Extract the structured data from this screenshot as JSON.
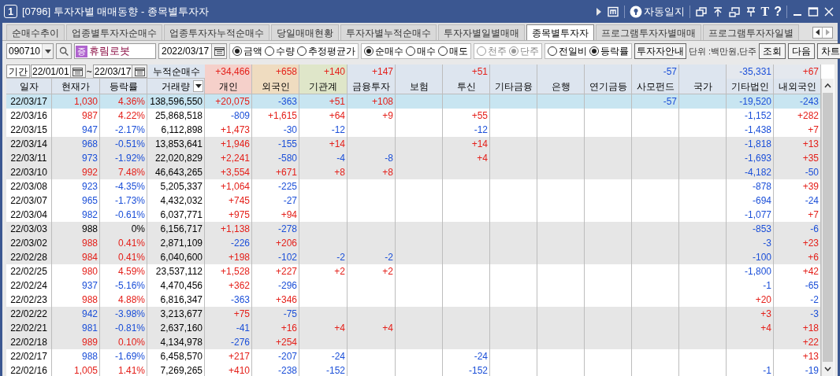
{
  "window": {
    "badge": "1",
    "title": "[0796] 투자자별 매매동향 - 종목별투자자",
    "journal_label": "자동일지",
    "text_tool": "T",
    "help": "?"
  },
  "tabs": [
    {
      "label": "순매수추이",
      "selected": false
    },
    {
      "label": "업종별투자자순매수",
      "selected": false
    },
    {
      "label": "업종투자자누적순매수",
      "selected": false
    },
    {
      "label": "당일매매현황",
      "selected": false
    },
    {
      "label": "투자자별누적순매수",
      "selected": false
    },
    {
      "label": "투자자별일별매매",
      "selected": false
    },
    {
      "label": "종목별투자자",
      "selected": true
    },
    {
      "label": "프로그램투자자별매매",
      "selected": false
    },
    {
      "label": "프로그램투자자일별",
      "selected": false
    }
  ],
  "filters": {
    "code": "090710",
    "market_badge": "증",
    "stock_name": "휴림로봇",
    "date": "2022/03/17",
    "radio_groups": [
      {
        "disabled": false,
        "options": [
          {
            "label": "금액",
            "selected": true
          },
          {
            "label": "수량",
            "selected": false
          },
          {
            "label": "추정평균가",
            "selected": false
          }
        ]
      },
      {
        "disabled": false,
        "options": [
          {
            "label": "순매수",
            "selected": true
          },
          {
            "label": "매수",
            "selected": false
          },
          {
            "label": "매도",
            "selected": false
          }
        ]
      },
      {
        "disabled": true,
        "options": [
          {
            "label": "천주",
            "selected": false
          },
          {
            "label": "단주",
            "selected": true
          }
        ]
      },
      {
        "disabled": false,
        "options": [
          {
            "label": "전일비",
            "selected": false
          },
          {
            "label": "등락률",
            "selected": true
          }
        ]
      }
    ],
    "guide_button": "투자자안내",
    "unit": "단위 :백만원,단주",
    "buttons": [
      "조회",
      "다음",
      "차트"
    ]
  },
  "period": {
    "label": "기간",
    "from": "22/01/01",
    "separator": "~",
    "to": "22/03/17"
  },
  "summary": {
    "label": "누적순매수",
    "flows": {
      "individual": {
        "t": "+34,466",
        "color": "#e4201a"
      },
      "foreign": {
        "t": "+658",
        "color": "#e4201a"
      },
      "institution": {
        "t": "+140",
        "color": "#e4201a"
      },
      "financial_investment": {
        "t": "+147",
        "color": "#e4201a"
      },
      "trust": {
        "t": "+51",
        "color": "#e4201a"
      },
      "private_fund": {
        "t": "-57",
        "color": "#1b4fd8"
      },
      "other_corp": {
        "t": "-35,331",
        "color": "#1b4fd8"
      },
      "domestic_foreign": {
        "t": "+67",
        "color": "#e4201a"
      }
    }
  },
  "table": {
    "columns": [
      "일자",
      "현재가",
      "등락률",
      "거래량",
      "개인",
      "외국인",
      "기관계",
      "금융투자",
      "보험",
      "투신",
      "기타금융",
      "은행",
      "연기금등",
      "사모펀드",
      "국가",
      "기타법인",
      "내외국인"
    ],
    "rows": [
      {
        "selected": true,
        "date": "22/03/17",
        "price": "1,030",
        "rate": "4.36%",
        "color": "#e4201a",
        "volume": "138,596,550",
        "flows": {
          "individual": {
            "t": "+20,075",
            "color": "#e4201a"
          },
          "foreign": {
            "t": "-363",
            "color": "#1b4fd8"
          },
          "institution": {
            "t": "+51",
            "color": "#e4201a"
          },
          "financial_investment": {
            "t": "+108",
            "color": "#e4201a"
          },
          "private_fund": {
            "t": "-57",
            "color": "#1b4fd8"
          },
          "other_corp": {
            "t": "-19,520",
            "color": "#1b4fd8"
          },
          "domestic_foreign": {
            "t": "-243",
            "color": "#1b4fd8"
          }
        }
      },
      {
        "selected": false,
        "date": "22/03/16",
        "price": "987",
        "rate": "4.22%",
        "color": "#e4201a",
        "volume": "25,868,518",
        "flows": {
          "individual": {
            "t": "-809",
            "color": "#1b4fd8"
          },
          "foreign": {
            "t": "+1,615",
            "color": "#e4201a"
          },
          "institution": {
            "t": "+64",
            "color": "#e4201a"
          },
          "financial_investment": {
            "t": "+9",
            "color": "#e4201a"
          },
          "trust": {
            "t": "+55",
            "color": "#e4201a"
          },
          "other_corp": {
            "t": "-1,152",
            "color": "#1b4fd8"
          },
          "domestic_foreign": {
            "t": "+282",
            "color": "#e4201a"
          }
        }
      },
      {
        "selected": false,
        "date": "22/03/15",
        "price": "947",
        "rate": "-2.17%",
        "color": "#1b4fd8",
        "volume": "6,112,898",
        "flows": {
          "individual": {
            "t": "+1,473",
            "color": "#e4201a"
          },
          "foreign": {
            "t": "-30",
            "color": "#1b4fd8"
          },
          "institution": {
            "t": "-12",
            "color": "#1b4fd8"
          },
          "trust": {
            "t": "-12",
            "color": "#1b4fd8"
          },
          "other_corp": {
            "t": "-1,438",
            "color": "#1b4fd8"
          },
          "domestic_foreign": {
            "t": "+7",
            "color": "#e4201a"
          }
        }
      },
      {
        "selected": false,
        "date": "22/03/14",
        "price": "968",
        "rate": "-0.51%",
        "color": "#1b4fd8",
        "volume": "13,853,641",
        "flows": {
          "individual": {
            "t": "+1,946",
            "color": "#e4201a"
          },
          "foreign": {
            "t": "-155",
            "color": "#1b4fd8"
          },
          "institution": {
            "t": "+14",
            "color": "#e4201a"
          },
          "trust": {
            "t": "+14",
            "color": "#e4201a"
          },
          "other_corp": {
            "t": "-1,818",
            "color": "#1b4fd8"
          },
          "domestic_foreign": {
            "t": "+13",
            "color": "#e4201a"
          }
        }
      },
      {
        "selected": false,
        "date": "22/03/11",
        "price": "973",
        "rate": "-1.92%",
        "color": "#1b4fd8",
        "volume": "22,020,829",
        "flows": {
          "individual": {
            "t": "+2,241",
            "color": "#e4201a"
          },
          "foreign": {
            "t": "-580",
            "color": "#1b4fd8"
          },
          "institution": {
            "t": "-4",
            "color": "#1b4fd8"
          },
          "financial_investment": {
            "t": "-8",
            "color": "#1b4fd8"
          },
          "trust": {
            "t": "+4",
            "color": "#e4201a"
          },
          "other_corp": {
            "t": "-1,693",
            "color": "#1b4fd8"
          },
          "domestic_foreign": {
            "t": "+35",
            "color": "#e4201a"
          }
        }
      },
      {
        "selected": false,
        "date": "22/03/10",
        "price": "992",
        "rate": "7.48%",
        "color": "#e4201a",
        "volume": "46,643,265",
        "flows": {
          "individual": {
            "t": "+3,554",
            "color": "#e4201a"
          },
          "foreign": {
            "t": "+671",
            "color": "#e4201a"
          },
          "institution": {
            "t": "+8",
            "color": "#e4201a"
          },
          "financial_investment": {
            "t": "+8",
            "color": "#e4201a"
          },
          "other_corp": {
            "t": "-4,182",
            "color": "#1b4fd8"
          },
          "domestic_foreign": {
            "t": "-50",
            "color": "#1b4fd8"
          }
        }
      },
      {
        "selected": false,
        "date": "22/03/08",
        "price": "923",
        "rate": "-4.35%",
        "color": "#1b4fd8",
        "volume": "5,205,337",
        "flows": {
          "individual": {
            "t": "+1,064",
            "color": "#e4201a"
          },
          "foreign": {
            "t": "-225",
            "color": "#1b4fd8"
          },
          "other_corp": {
            "t": "-878",
            "color": "#1b4fd8"
          },
          "domestic_foreign": {
            "t": "+39",
            "color": "#e4201a"
          }
        }
      },
      {
        "selected": false,
        "date": "22/03/07",
        "price": "965",
        "rate": "-1.73%",
        "color": "#1b4fd8",
        "volume": "4,432,032",
        "flows": {
          "individual": {
            "t": "+745",
            "color": "#e4201a"
          },
          "foreign": {
            "t": "-27",
            "color": "#1b4fd8"
          },
          "other_corp": {
            "t": "-694",
            "color": "#1b4fd8"
          },
          "domestic_foreign": {
            "t": "-24",
            "color": "#1b4fd8"
          }
        }
      },
      {
        "selected": false,
        "date": "22/03/04",
        "price": "982",
        "rate": "-0.61%",
        "color": "#1b4fd8",
        "volume": "6,037,771",
        "flows": {
          "individual": {
            "t": "+975",
            "color": "#e4201a"
          },
          "foreign": {
            "t": "+94",
            "color": "#e4201a"
          },
          "other_corp": {
            "t": "-1,077",
            "color": "#1b4fd8"
          },
          "domestic_foreign": {
            "t": "+7",
            "color": "#e4201a"
          }
        }
      },
      {
        "selected": false,
        "date": "22/03/03",
        "price": "988",
        "rate": "0%",
        "color": "#000000",
        "volume": "6,156,717",
        "flows": {
          "individual": {
            "t": "+1,138",
            "color": "#e4201a"
          },
          "foreign": {
            "t": "-278",
            "color": "#1b4fd8"
          },
          "other_corp": {
            "t": "-853",
            "color": "#1b4fd8"
          },
          "domestic_foreign": {
            "t": "-6",
            "color": "#1b4fd8"
          }
        }
      },
      {
        "selected": false,
        "date": "22/03/02",
        "price": "988",
        "rate": "0.41%",
        "color": "#e4201a",
        "volume": "2,871,109",
        "flows": {
          "individual": {
            "t": "-226",
            "color": "#1b4fd8"
          },
          "foreign": {
            "t": "+206",
            "color": "#e4201a"
          },
          "other_corp": {
            "t": "-3",
            "color": "#1b4fd8"
          },
          "domestic_foreign": {
            "t": "+23",
            "color": "#e4201a"
          }
        }
      },
      {
        "selected": false,
        "date": "22/02/28",
        "price": "984",
        "rate": "0.41%",
        "color": "#e4201a",
        "volume": "6,040,600",
        "flows": {
          "individual": {
            "t": "+198",
            "color": "#e4201a"
          },
          "foreign": {
            "t": "-102",
            "color": "#1b4fd8"
          },
          "institution": {
            "t": "-2",
            "color": "#1b4fd8"
          },
          "financial_investment": {
            "t": "-2",
            "color": "#1b4fd8"
          },
          "other_corp": {
            "t": "-100",
            "color": "#1b4fd8"
          },
          "domestic_foreign": {
            "t": "+6",
            "color": "#e4201a"
          }
        }
      },
      {
        "selected": false,
        "date": "22/02/25",
        "price": "980",
        "rate": "4.59%",
        "color": "#e4201a",
        "volume": "23,537,112",
        "flows": {
          "individual": {
            "t": "+1,528",
            "color": "#e4201a"
          },
          "foreign": {
            "t": "+227",
            "color": "#e4201a"
          },
          "institution": {
            "t": "+2",
            "color": "#e4201a"
          },
          "financial_investment": {
            "t": "+2",
            "color": "#e4201a"
          },
          "other_corp": {
            "t": "-1,800",
            "color": "#1b4fd8"
          },
          "domestic_foreign": {
            "t": "+42",
            "color": "#e4201a"
          }
        }
      },
      {
        "selected": false,
        "date": "22/02/24",
        "price": "937",
        "rate": "-5.16%",
        "color": "#1b4fd8",
        "volume": "4,470,456",
        "flows": {
          "individual": {
            "t": "+362",
            "color": "#e4201a"
          },
          "foreign": {
            "t": "-296",
            "color": "#1b4fd8"
          },
          "other_corp": {
            "t": "-1",
            "color": "#1b4fd8"
          },
          "domestic_foreign": {
            "t": "-65",
            "color": "#1b4fd8"
          }
        }
      },
      {
        "selected": false,
        "date": "22/02/23",
        "price": "988",
        "rate": "4.88%",
        "color": "#e4201a",
        "volume": "6,816,347",
        "flows": {
          "individual": {
            "t": "-363",
            "color": "#1b4fd8"
          },
          "foreign": {
            "t": "+346",
            "color": "#e4201a"
          },
          "other_corp": {
            "t": "+20",
            "color": "#e4201a"
          },
          "domestic_foreign": {
            "t": "-2",
            "color": "#1b4fd8"
          }
        }
      },
      {
        "selected": false,
        "date": "22/02/22",
        "price": "942",
        "rate": "-3.98%",
        "color": "#1b4fd8",
        "volume": "3,213,677",
        "flows": {
          "individual": {
            "t": "+75",
            "color": "#e4201a"
          },
          "foreign": {
            "t": "-75",
            "color": "#1b4fd8"
          },
          "other_corp": {
            "t": "+3",
            "color": "#e4201a"
          },
          "domestic_foreign": {
            "t": "-3",
            "color": "#1b4fd8"
          }
        }
      },
      {
        "selected": false,
        "date": "22/02/21",
        "price": "981",
        "rate": "-0.81%",
        "color": "#1b4fd8",
        "volume": "2,637,160",
        "flows": {
          "individual": {
            "t": "-41",
            "color": "#1b4fd8"
          },
          "foreign": {
            "t": "+16",
            "color": "#e4201a"
          },
          "institution": {
            "t": "+4",
            "color": "#e4201a"
          },
          "financial_investment": {
            "t": "+4",
            "color": "#e4201a"
          },
          "other_corp": {
            "t": "+4",
            "color": "#e4201a"
          },
          "domestic_foreign": {
            "t": "+18",
            "color": "#e4201a"
          }
        }
      },
      {
        "selected": false,
        "date": "22/02/18",
        "price": "989",
        "rate": "0.10%",
        "color": "#e4201a",
        "volume": "4,134,978",
        "flows": {
          "individual": {
            "t": "-276",
            "color": "#1b4fd8"
          },
          "foreign": {
            "t": "+254",
            "color": "#e4201a"
          },
          "domestic_foreign": {
            "t": "+22",
            "color": "#e4201a"
          }
        }
      },
      {
        "selected": false,
        "date": "22/02/17",
        "price": "988",
        "rate": "-1.69%",
        "color": "#1b4fd8",
        "volume": "6,458,570",
        "flows": {
          "individual": {
            "t": "+217",
            "color": "#e4201a"
          },
          "foreign": {
            "t": "-207",
            "color": "#1b4fd8"
          },
          "institution": {
            "t": "-24",
            "color": "#1b4fd8"
          },
          "trust": {
            "t": "-24",
            "color": "#1b4fd8"
          },
          "domestic_foreign": {
            "t": "+13",
            "color": "#e4201a"
          }
        }
      },
      {
        "selected": false,
        "date": "22/02/16",
        "price": "1,005",
        "rate": "1.41%",
        "color": "#e4201a",
        "volume": "7,269,265",
        "flows": {
          "individual": {
            "t": "+410",
            "color": "#e4201a"
          },
          "foreign": {
            "t": "-238",
            "color": "#1b4fd8"
          },
          "institution": {
            "t": "-152",
            "color": "#1b4fd8"
          },
          "trust": {
            "t": "-152",
            "color": "#1b4fd8"
          },
          "other_corp": {
            "t": "-1",
            "color": "#1b4fd8"
          },
          "domestic_foreign": {
            "t": "-19",
            "color": "#1b4fd8"
          }
        }
      }
    ]
  }
}
